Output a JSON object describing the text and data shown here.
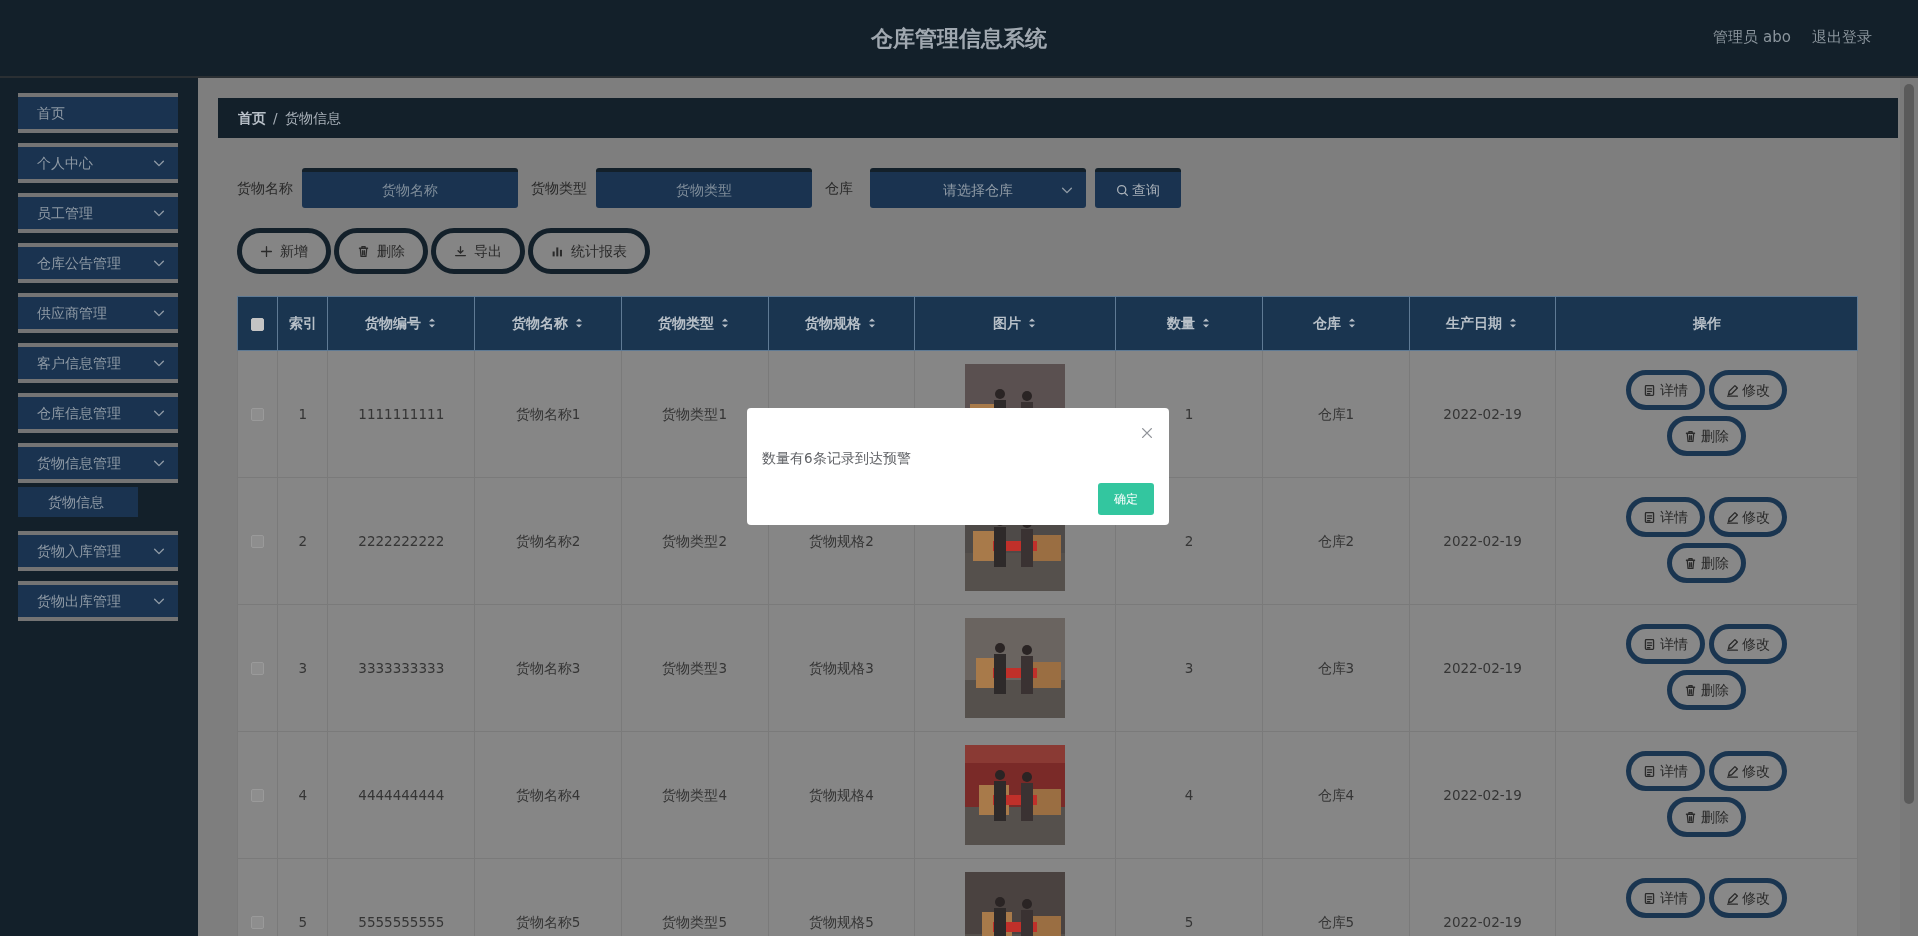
{
  "header": {
    "title": "仓库管理信息系统",
    "user": "管理员 abo",
    "logout": "退出登录"
  },
  "sidebar": {
    "items": [
      {
        "label": "首页",
        "kind": "link"
      },
      {
        "label": "个人中心",
        "kind": "group"
      },
      {
        "label": "员工管理",
        "kind": "group"
      },
      {
        "label": "仓库公告管理",
        "kind": "group"
      },
      {
        "label": "供应商管理",
        "kind": "group"
      },
      {
        "label": "客户信息管理",
        "kind": "group"
      },
      {
        "label": "仓库信息管理",
        "kind": "group"
      },
      {
        "label": "货物信息管理",
        "kind": "group",
        "children": [
          {
            "label": "货物信息"
          }
        ]
      },
      {
        "label": "货物入库管理",
        "kind": "group"
      },
      {
        "label": "货物出库管理",
        "kind": "group"
      }
    ]
  },
  "breadcrumb": {
    "items": [
      "首页",
      "货物信息"
    ],
    "separator": "/"
  },
  "search": {
    "fields": [
      {
        "label": "货物名称",
        "placeholder": "货物名称",
        "kind": "text"
      },
      {
        "label": "货物类型",
        "placeholder": "货物类型",
        "kind": "text"
      },
      {
        "label": "仓库",
        "placeholder": "请选择仓库",
        "kind": "select"
      }
    ],
    "button": "查询"
  },
  "toolbar": [
    {
      "label": "新增",
      "kind": "add"
    },
    {
      "label": "删除",
      "kind": "delete"
    },
    {
      "label": "导出",
      "kind": "export"
    },
    {
      "label": "统计报表",
      "kind": "report"
    }
  ],
  "table": {
    "select_all": {
      "checked": false
    },
    "columns": [
      {
        "label": "索引",
        "sortable": false
      },
      {
        "label": "货物编号",
        "sortable": true
      },
      {
        "label": "货物名称",
        "sortable": true
      },
      {
        "label": "货物类型",
        "sortable": true
      },
      {
        "label": "货物规格",
        "sortable": true
      },
      {
        "label": "图片",
        "sortable": true
      },
      {
        "label": "数量",
        "sortable": true
      },
      {
        "label": "仓库",
        "sortable": true
      },
      {
        "label": "生产日期",
        "sortable": true
      },
      {
        "label": "操作",
        "sortable": false
      }
    ],
    "rows": [
      {
        "selected": false,
        "cells": [
          "1",
          "1111111111",
          "货物名称1",
          "货物类型1",
          null,
          null,
          "1",
          "仓库1",
          "2022-02-19"
        ],
        "picture": {
          "kind": "picture"
        },
        "actions": [
          {
            "label": "详情",
            "kind": "detail"
          },
          {
            "label": "修改",
            "kind": "edit"
          },
          {
            "label": "删除",
            "kind": "delete"
          }
        ]
      },
      {
        "selected": false,
        "cells": [
          "2",
          "2222222222",
          "货物名称2",
          "货物类型2",
          "货物规格2",
          null,
          "2",
          "仓库2",
          "2022-02-19"
        ],
        "picture": {
          "kind": "picture"
        },
        "actions": [
          {
            "label": "详情",
            "kind": "detail"
          },
          {
            "label": "修改",
            "kind": "edit"
          },
          {
            "label": "删除",
            "kind": "delete"
          }
        ]
      },
      {
        "selected": false,
        "cells": [
          "3",
          "3333333333",
          "货物名称3",
          "货物类型3",
          "货物规格3",
          null,
          "3",
          "仓库3",
          "2022-02-19"
        ],
        "picture": {
          "kind": "picture"
        },
        "actions": [
          {
            "label": "详情",
            "kind": "detail"
          },
          {
            "label": "修改",
            "kind": "edit"
          },
          {
            "label": "删除",
            "kind": "delete"
          }
        ]
      },
      {
        "selected": false,
        "cells": [
          "4",
          "4444444444",
          "货物名称4",
          "货物类型4",
          "货物规格4",
          null,
          "4",
          "仓库4",
          "2022-02-19"
        ],
        "picture": {
          "kind": "picture"
        },
        "actions": [
          {
            "label": "详情",
            "kind": "detail"
          },
          {
            "label": "修改",
            "kind": "edit"
          },
          {
            "label": "删除",
            "kind": "delete"
          }
        ]
      },
      {
        "selected": false,
        "cells": [
          "5",
          "5555555555",
          "货物名称5",
          "货物类型5",
          "货物规格5",
          null,
          "5",
          "仓库5",
          "2022-02-19"
        ],
        "picture": {
          "kind": "picture"
        },
        "actions": [
          {
            "label": "详情",
            "kind": "detail"
          },
          {
            "label": "修改",
            "kind": "edit"
          }
        ]
      }
    ]
  },
  "dialog": {
    "message": "数量有6条记录到达预警",
    "button": "确定"
  }
}
